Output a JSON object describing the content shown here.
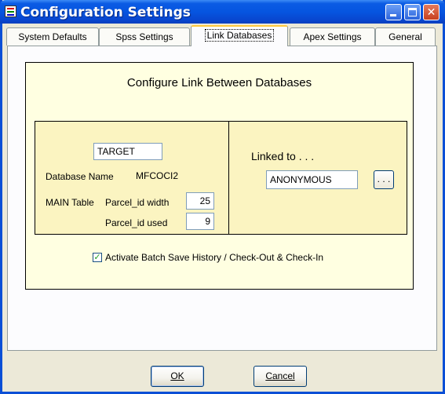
{
  "window": {
    "title": "Configuration Settings",
    "titlebar_color": "#0655e0",
    "icon": "settings-app-icon",
    "minimize_icon": "minimize-icon",
    "maximize_icon": "maximize-icon",
    "close_icon": "close-icon",
    "close_glyph": "✕"
  },
  "tabs": [
    {
      "label": "System Defaults"
    },
    {
      "label": "Spss Settings"
    },
    {
      "label": "Link Databases",
      "active": true
    },
    {
      "label": "Apex Settings"
    },
    {
      "label": "General"
    }
  ],
  "link_panel": {
    "heading": "Configure Link Between Databases",
    "target_value": "TARGET",
    "database_name_label": "Database Name",
    "database_name_value": "MFCOCI2",
    "main_table_label": "MAIN Table",
    "parcel_id_width_label": "Parcel_id width",
    "parcel_id_width_value": "25",
    "parcel_id_used_label": "Parcel_id used",
    "parcel_id_used_value": "9",
    "linked_to_label": "Linked to . . .",
    "linked_to_value": "ANONYMOUS",
    "browse_label": ". . .",
    "panel_color": "#ffffe1",
    "inner_color": "#fbf4c1"
  },
  "batch_history": {
    "checked": true,
    "check_glyph": "✓",
    "label": "Activate Batch Save History / Check-Out & Check-In"
  },
  "buttons": {
    "ok_label": "OK",
    "cancel_label": "Cancel"
  }
}
